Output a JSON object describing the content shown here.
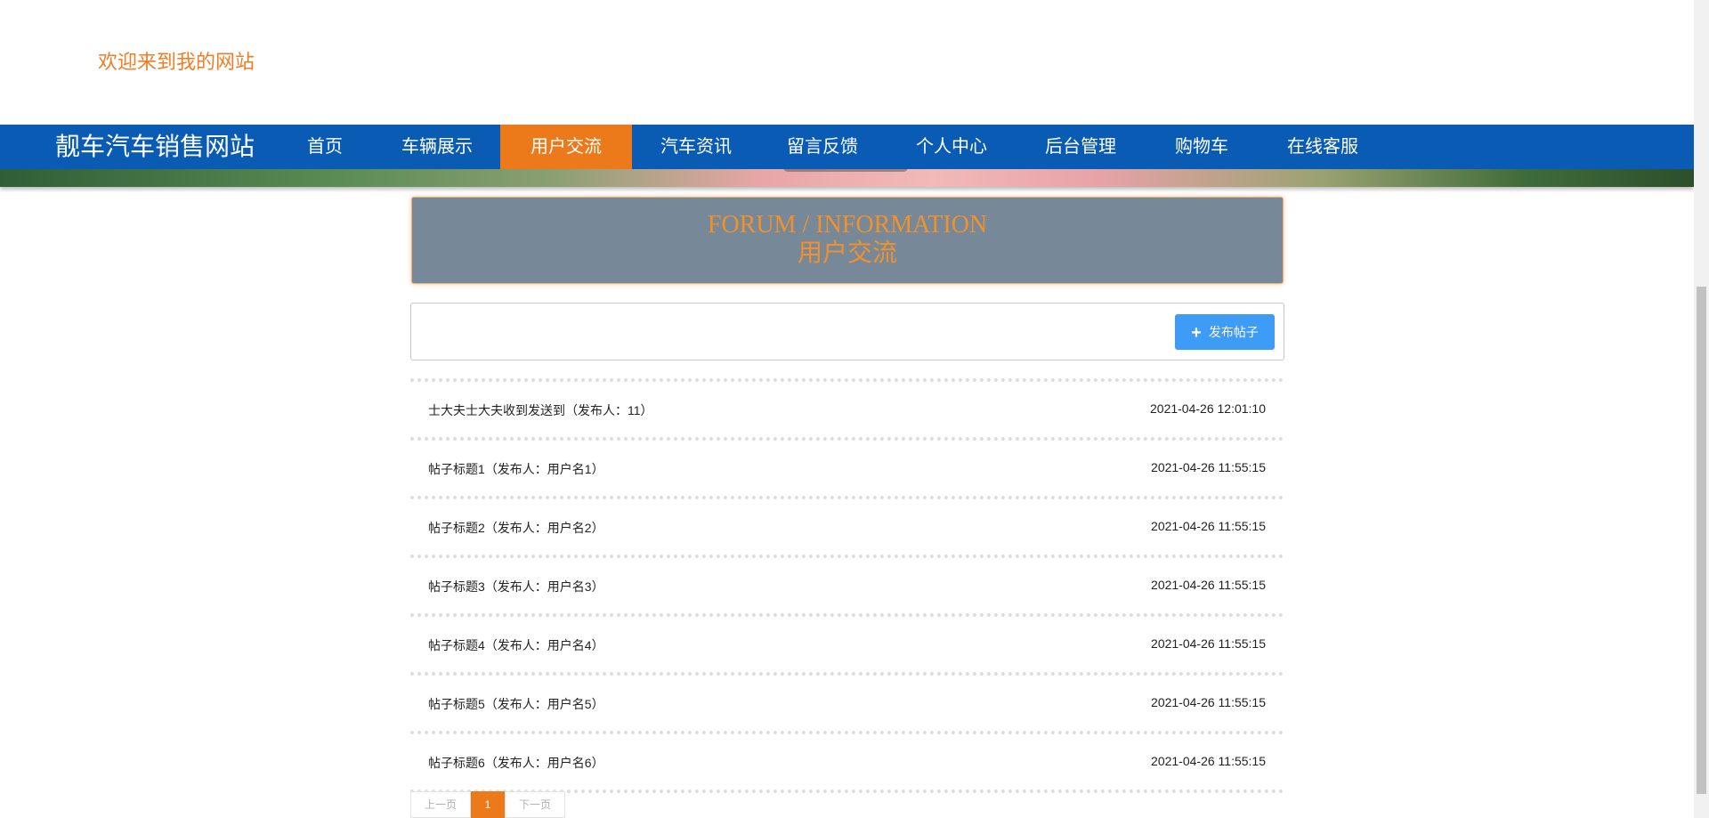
{
  "header": {
    "welcome": "欢迎来到我的网站"
  },
  "nav": {
    "brand": "靓车汽车销售网站",
    "items": [
      {
        "label": "首页"
      },
      {
        "label": "车辆展示"
      },
      {
        "label": "用户交流"
      },
      {
        "label": "汽车资讯"
      },
      {
        "label": "留言反馈"
      },
      {
        "label": "个人中心"
      },
      {
        "label": "后台管理"
      },
      {
        "label": "购物车"
      },
      {
        "label": "在线客服"
      }
    ],
    "active_index": 2
  },
  "section": {
    "title_en": "FORUM / INFORMATION",
    "title_zh": "用户交流"
  },
  "toolbar": {
    "post_button_label": "发布帖子"
  },
  "posts": [
    {
      "title": "士大夫士大夫收到发送到（发布人：11）",
      "time": "2021-04-26 12:01:10"
    },
    {
      "title": "帖子标题1（发布人：用户名1）",
      "time": "2021-04-26 11:55:15"
    },
    {
      "title": "帖子标题2（发布人：用户名2）",
      "time": "2021-04-26 11:55:15"
    },
    {
      "title": "帖子标题3（发布人：用户名3）",
      "time": "2021-04-26 11:55:15"
    },
    {
      "title": "帖子标题4（发布人：用户名4）",
      "time": "2021-04-26 11:55:15"
    },
    {
      "title": "帖子标题5（发布人：用户名5）",
      "time": "2021-04-26 11:55:15"
    },
    {
      "title": "帖子标题6（发布人：用户名6）",
      "time": "2021-04-26 11:55:15"
    }
  ],
  "pagination": {
    "prev": "上一页",
    "current": "1",
    "next": "下一页"
  },
  "colors": {
    "nav_bg": "#0a5bb3",
    "accent": "#ec7a1a",
    "header_bg": "#778899",
    "button_blue": "#3e9cf7"
  },
  "icons": {
    "post_button_icon": "plus-icon"
  }
}
